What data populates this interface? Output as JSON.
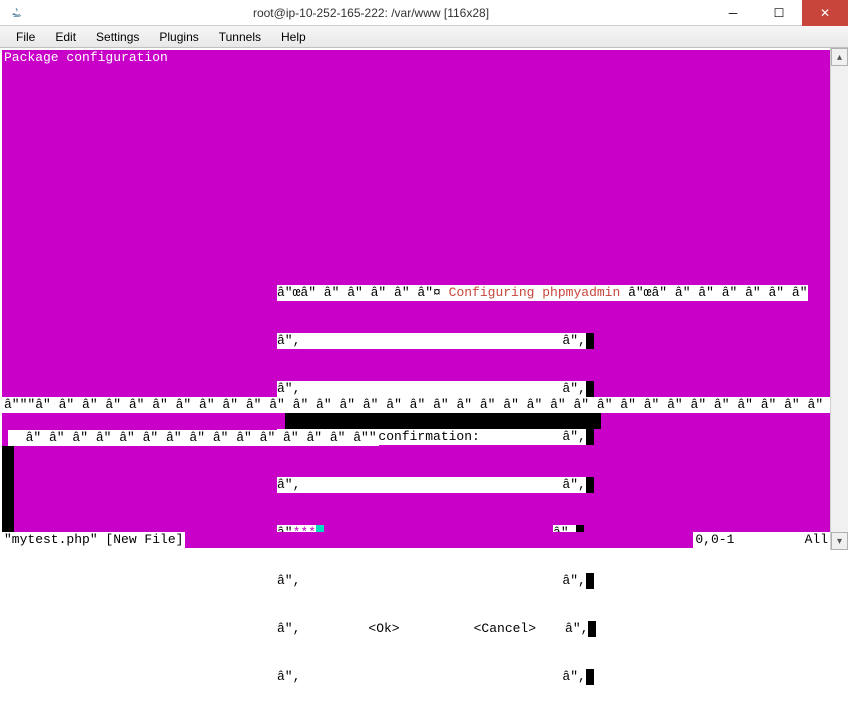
{
  "window": {
    "title": "root@ip-10-252-165-222: /var/www [116x28]"
  },
  "menu": {
    "file": "File",
    "edit": "Edit",
    "settings": "Settings",
    "plugins": "Plugins",
    "tunnels": "Tunnels",
    "help": "Help"
  },
  "terminal": {
    "package_config": "Package configuration",
    "border_segment_left": "â\"œâ\" â\" â\" â\" â\" â\"¤ ",
    "dialog_title": "Configuring phpmyadmin",
    "border_segment_right": " â\"œâ\" â\" â\" â\" â\" â\" â\"",
    "side_char": "â\",",
    "prompt": " Password confirmation:",
    "password_value": "***",
    "ok": "<Ok>",
    "cancel": "<Cancel>",
    "bottom_row": "â\"\"\"â\" â\" â\" â\" â\" â\" â\" â\" â\" â\" â\" â\" â\" â\" â\" â\" â\" â\" â\" â\" â\" â\" â\" â\" â\" â\" â\" â\" â\" â\" â\" â\" â\" â\" â\" â\" â\" â\" â\" â\" â\" â\" â\" â\" â\" â\" â\" â\" â\" â\" â\" â\" â\" â\"",
    "small_strip": "  â\" â\" â\" â\" â\" â\" â\" â\" â\" â\" â\" â\" â\" â\" â\"\"",
    "status_left": "\"mytest.php\" [New File]",
    "status_right": "0,0-1         All"
  }
}
